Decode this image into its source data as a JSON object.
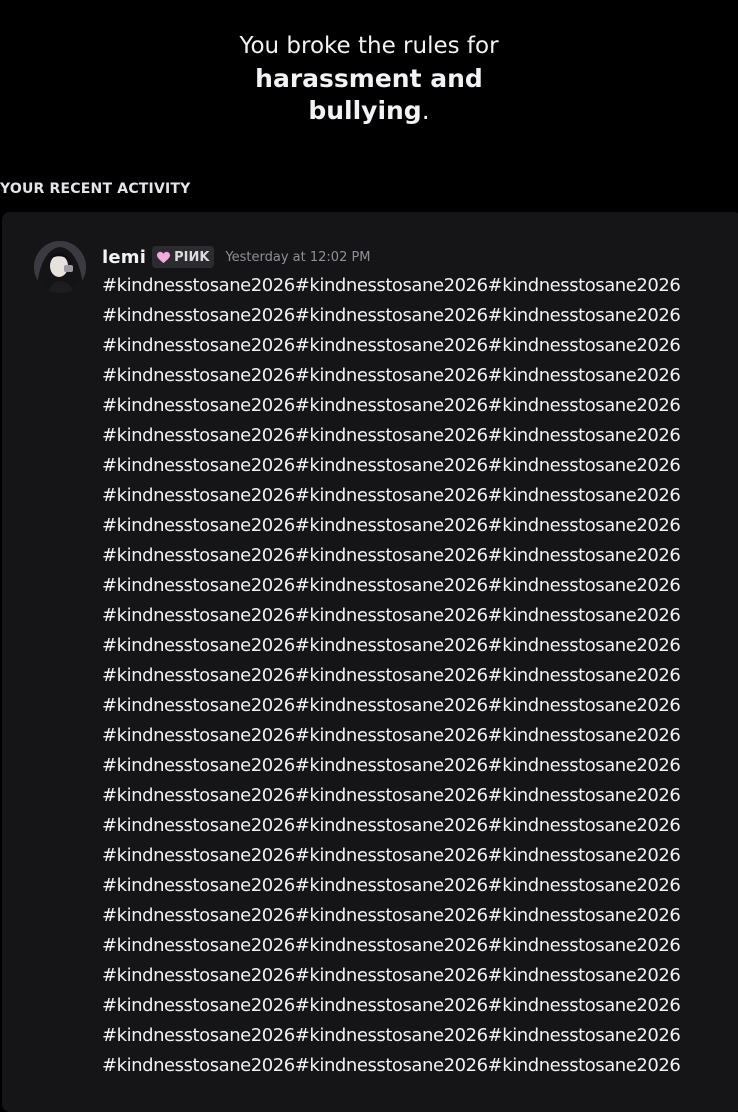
{
  "header": {
    "line1": "You broke the rules for",
    "line2_bold": "harassment and bullying",
    "line2_end": "."
  },
  "section": {
    "label": "YOUR RECENT ACTIVITY"
  },
  "message": {
    "username": "lemi",
    "tag": "PIИK",
    "tag_icon": "heart-icon",
    "tag_icon_color": "#f5a9dd",
    "timestamp": "Yesterday at 12:02 PM",
    "lines": [
      "#kindnesstosane2026#kindnesstosane2026#kindnesstosane2026",
      "#kindnesstosane2026#kindnesstosane2026#kindnesstosane2026",
      "#kindnesstosane2026#kindnesstosane2026#kindnesstosane2026",
      "#kindnesstosane2026#kindnesstosane2026#kindnesstosane2026",
      "#kindnesstosane2026#kindnesstosane2026#kindnesstosane2026",
      "#kindnesstosane2026#kindnesstosane2026#kindnesstosane2026",
      "#kindnesstosane2026#kindnesstosane2026#kindnesstosane2026",
      "#kindnesstosane2026#kindnesstosane2026#kindnesstosane2026",
      "#kindnesstosane2026#kindnesstosane2026#kindnesstosane2026",
      "#kindnesstosane2026#kindnesstosane2026#kindnesstosane2026",
      "#kindnesstosane2026#kindnesstosane2026#kindnesstosane2026",
      "#kindnesstosane2026#kindnesstosane2026#kindnesstosane2026",
      "#kindnesstosane2026#kindnesstosane2026#kindnesstosane2026",
      "#kindnesstosane2026#kindnesstosane2026#kindnesstosane2026",
      "#kindnesstosane2026#kindnesstosane2026#kindnesstosane2026",
      "#kindnesstosane2026#kindnesstosane2026#kindnesstosane2026",
      "#kindnesstosane2026#kindnesstosane2026#kindnesstosane2026",
      "#kindnesstosane2026#kindnesstosane2026#kindnesstosane2026",
      "#kindnesstosane2026#kindnesstosane2026#kindnesstosane2026",
      "#kindnesstosane2026#kindnesstosane2026#kindnesstosane2026",
      "#kindnesstosane2026#kindnesstosane2026#kindnesstosane2026",
      "#kindnesstosane2026#kindnesstosane2026#kindnesstosane2026",
      "#kindnesstosane2026#kindnesstosane2026#kindnesstosane2026",
      "#kindnesstosane2026#kindnesstosane2026#kindnesstosane2026",
      "#kindnesstosane2026#kindnesstosane2026#kindnesstosane2026",
      "#kindnesstosane2026#kindnesstosane2026#kindnesstosane2026",
      "#kindnesstosane2026#kindnesstosane2026#kindnesstosane2026"
    ]
  }
}
